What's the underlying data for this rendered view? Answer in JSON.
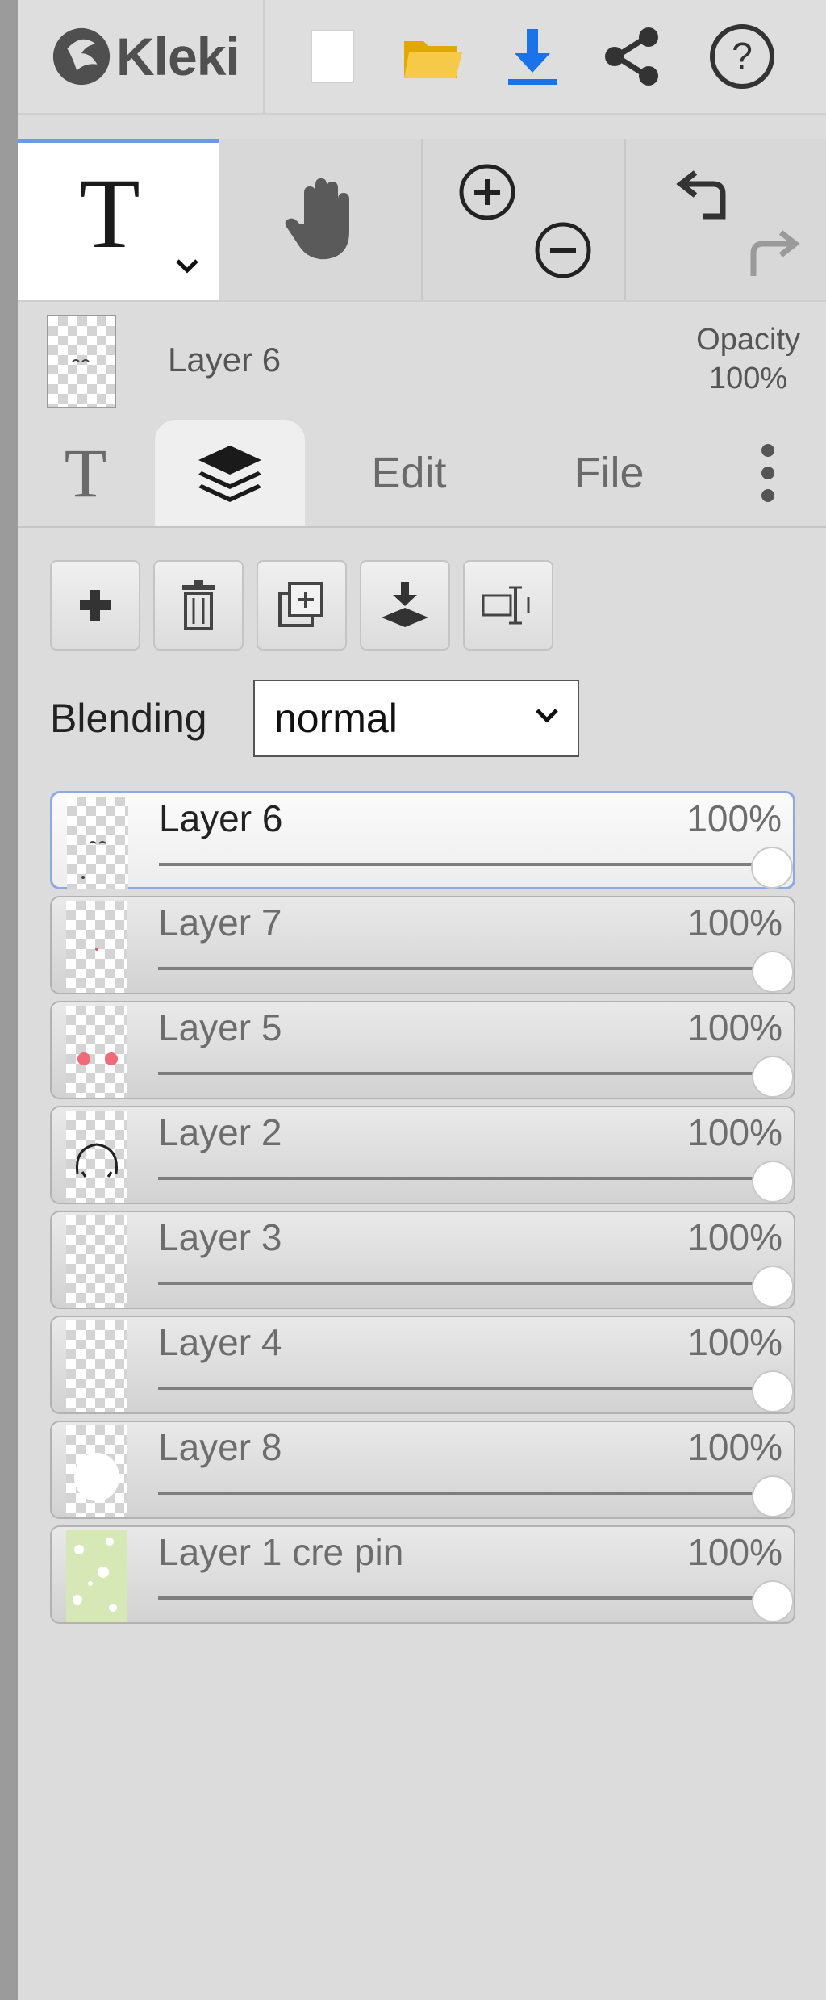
{
  "app": {
    "name": "Kleki"
  },
  "header": {
    "buttons": [
      {
        "name": "new-image-button",
        "icon": "new-file-icon"
      },
      {
        "name": "open-button",
        "icon": "folder-icon"
      },
      {
        "name": "save-button",
        "icon": "download-icon"
      },
      {
        "name": "share-button",
        "icon": "share-icon"
      },
      {
        "name": "help-button",
        "icon": "help-icon",
        "glyph": "?"
      }
    ]
  },
  "tools": {
    "text_tool": {
      "glyph": "T",
      "icon": "text-tool-icon"
    },
    "hand_tool": {
      "icon": "hand-icon"
    },
    "zoom": {
      "in_icon": "zoom-in-icon",
      "out_icon": "zoom-out-icon"
    },
    "history": {
      "undo_icon": "undo-icon",
      "redo_icon": "redo-icon"
    }
  },
  "current_layer": {
    "name": "Layer 6",
    "opacity_label": "Opacity",
    "opacity_value": "100%"
  },
  "tabs": [
    {
      "label": "T",
      "icon": "text-tab-icon"
    },
    {
      "label": "",
      "icon": "layers-icon",
      "active": true
    },
    {
      "label": "Edit"
    },
    {
      "label": "File"
    },
    {
      "label": "",
      "icon": "more-vertical-icon"
    }
  ],
  "layer_actions": [
    "add-layer-icon",
    "delete-layer-icon",
    "duplicate-layer-icon",
    "merge-down-icon",
    "rename-layer-icon"
  ],
  "blending": {
    "label": "Blending",
    "value": "normal"
  },
  "layers": [
    {
      "name": "Layer 6",
      "opacity": "100%",
      "opacity_value": 1.0,
      "selected": true,
      "thumb": "face"
    },
    {
      "name": "Layer 7",
      "opacity": "100%",
      "opacity_value": 1.0,
      "thumb": "dot"
    },
    {
      "name": "Layer 5",
      "opacity": "100%",
      "opacity_value": 1.0,
      "thumb": "cheeks"
    },
    {
      "name": "Layer 2",
      "opacity": "100%",
      "opacity_value": 1.0,
      "thumb": "outline"
    },
    {
      "name": "Layer 3",
      "opacity": "100%",
      "opacity_value": 1.0,
      "thumb": "empty"
    },
    {
      "name": "Layer 4",
      "opacity": "100%",
      "opacity_value": 1.0,
      "thumb": "empty"
    },
    {
      "name": "Layer 8",
      "opacity": "100%",
      "opacity_value": 1.0,
      "thumb": "white-blob"
    },
    {
      "name": "Layer 1 cre pin",
      "opacity": "100%",
      "opacity_value": 1.0,
      "thumb": "green-pattern"
    }
  ],
  "colors": {
    "accent": "#1a73e8",
    "folder": "#f5c518",
    "selected_border": "#8ca9e5",
    "panel": "#dcdcdc"
  }
}
